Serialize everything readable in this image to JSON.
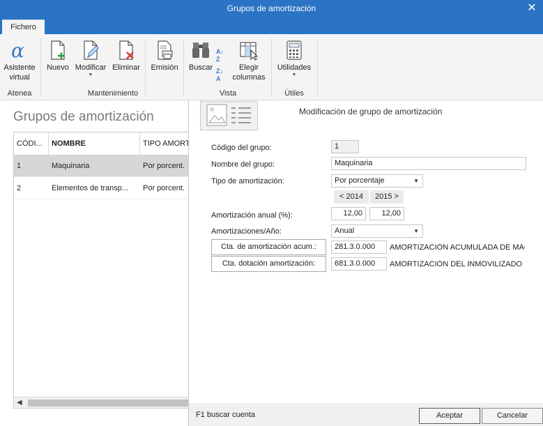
{
  "window": {
    "title": "Grupos de amortización"
  },
  "tabs": [
    {
      "label": "Fichero"
    }
  ],
  "ribbon": {
    "buttons": {
      "asistente": "Asistente\nvirtual",
      "nuevo": "Nuevo",
      "modificar": "Modificar",
      "eliminar": "Eliminar",
      "emision": "Emisión",
      "buscar": "Buscar",
      "elegir_columnas": "Elegir\ncolumnas",
      "utilidades": "Utilidades"
    },
    "groups": {
      "atenea": "Atenea",
      "mantenimiento": "Mantenimiento",
      "vista": "Vista",
      "utiles": "Útiles"
    }
  },
  "list": {
    "title": "Grupos de amortización",
    "columns": [
      "CÓDI...",
      "NOMBRE",
      "TIPO AMORT"
    ],
    "rows": [
      [
        "1",
        "Maquinaria",
        "Por porcent."
      ],
      [
        "2",
        "Elementos de transp...",
        "Por porcent."
      ]
    ]
  },
  "form": {
    "title": "Modificación de grupo de amortización",
    "codigo_label": "Código del grupo:",
    "codigo_value": "1",
    "nombre_label": "Nombre del grupo:",
    "nombre_value": "Maquinaria",
    "tipo_label": "Tipo de amortización:",
    "tipo_value": "Por porcentaje",
    "year_prev": "< 2014",
    "year_next": "2015 >",
    "anual_label": "Amortización anual (%):",
    "anual_2014": "12,00",
    "anual_2015": "12,00",
    "amort_ano_label": "Amortizaciones/Año:",
    "amort_ano_value": "Anual",
    "cta_acum_button": "Cta. de amortización acum.:",
    "cta_acum_value": "281.3.0.000",
    "cta_acum_desc": "AMORTIZACIÓN ACUMULADA DE MAQ",
    "cta_dot_button": "Cta. dotación amortización:",
    "cta_dot_value": "681.3.0.000",
    "cta_dot_desc": "AMORTIZACIÓN DEL INMOVILIZADO M"
  },
  "footer": {
    "hint": "F1 buscar cuenta",
    "accept": "Aceptar",
    "cancel": "Cancelar"
  },
  "colors": {
    "titlebar": "#2b73c4",
    "ribbon": "#f4f4f4",
    "selected_row": "#d6d6d6"
  }
}
